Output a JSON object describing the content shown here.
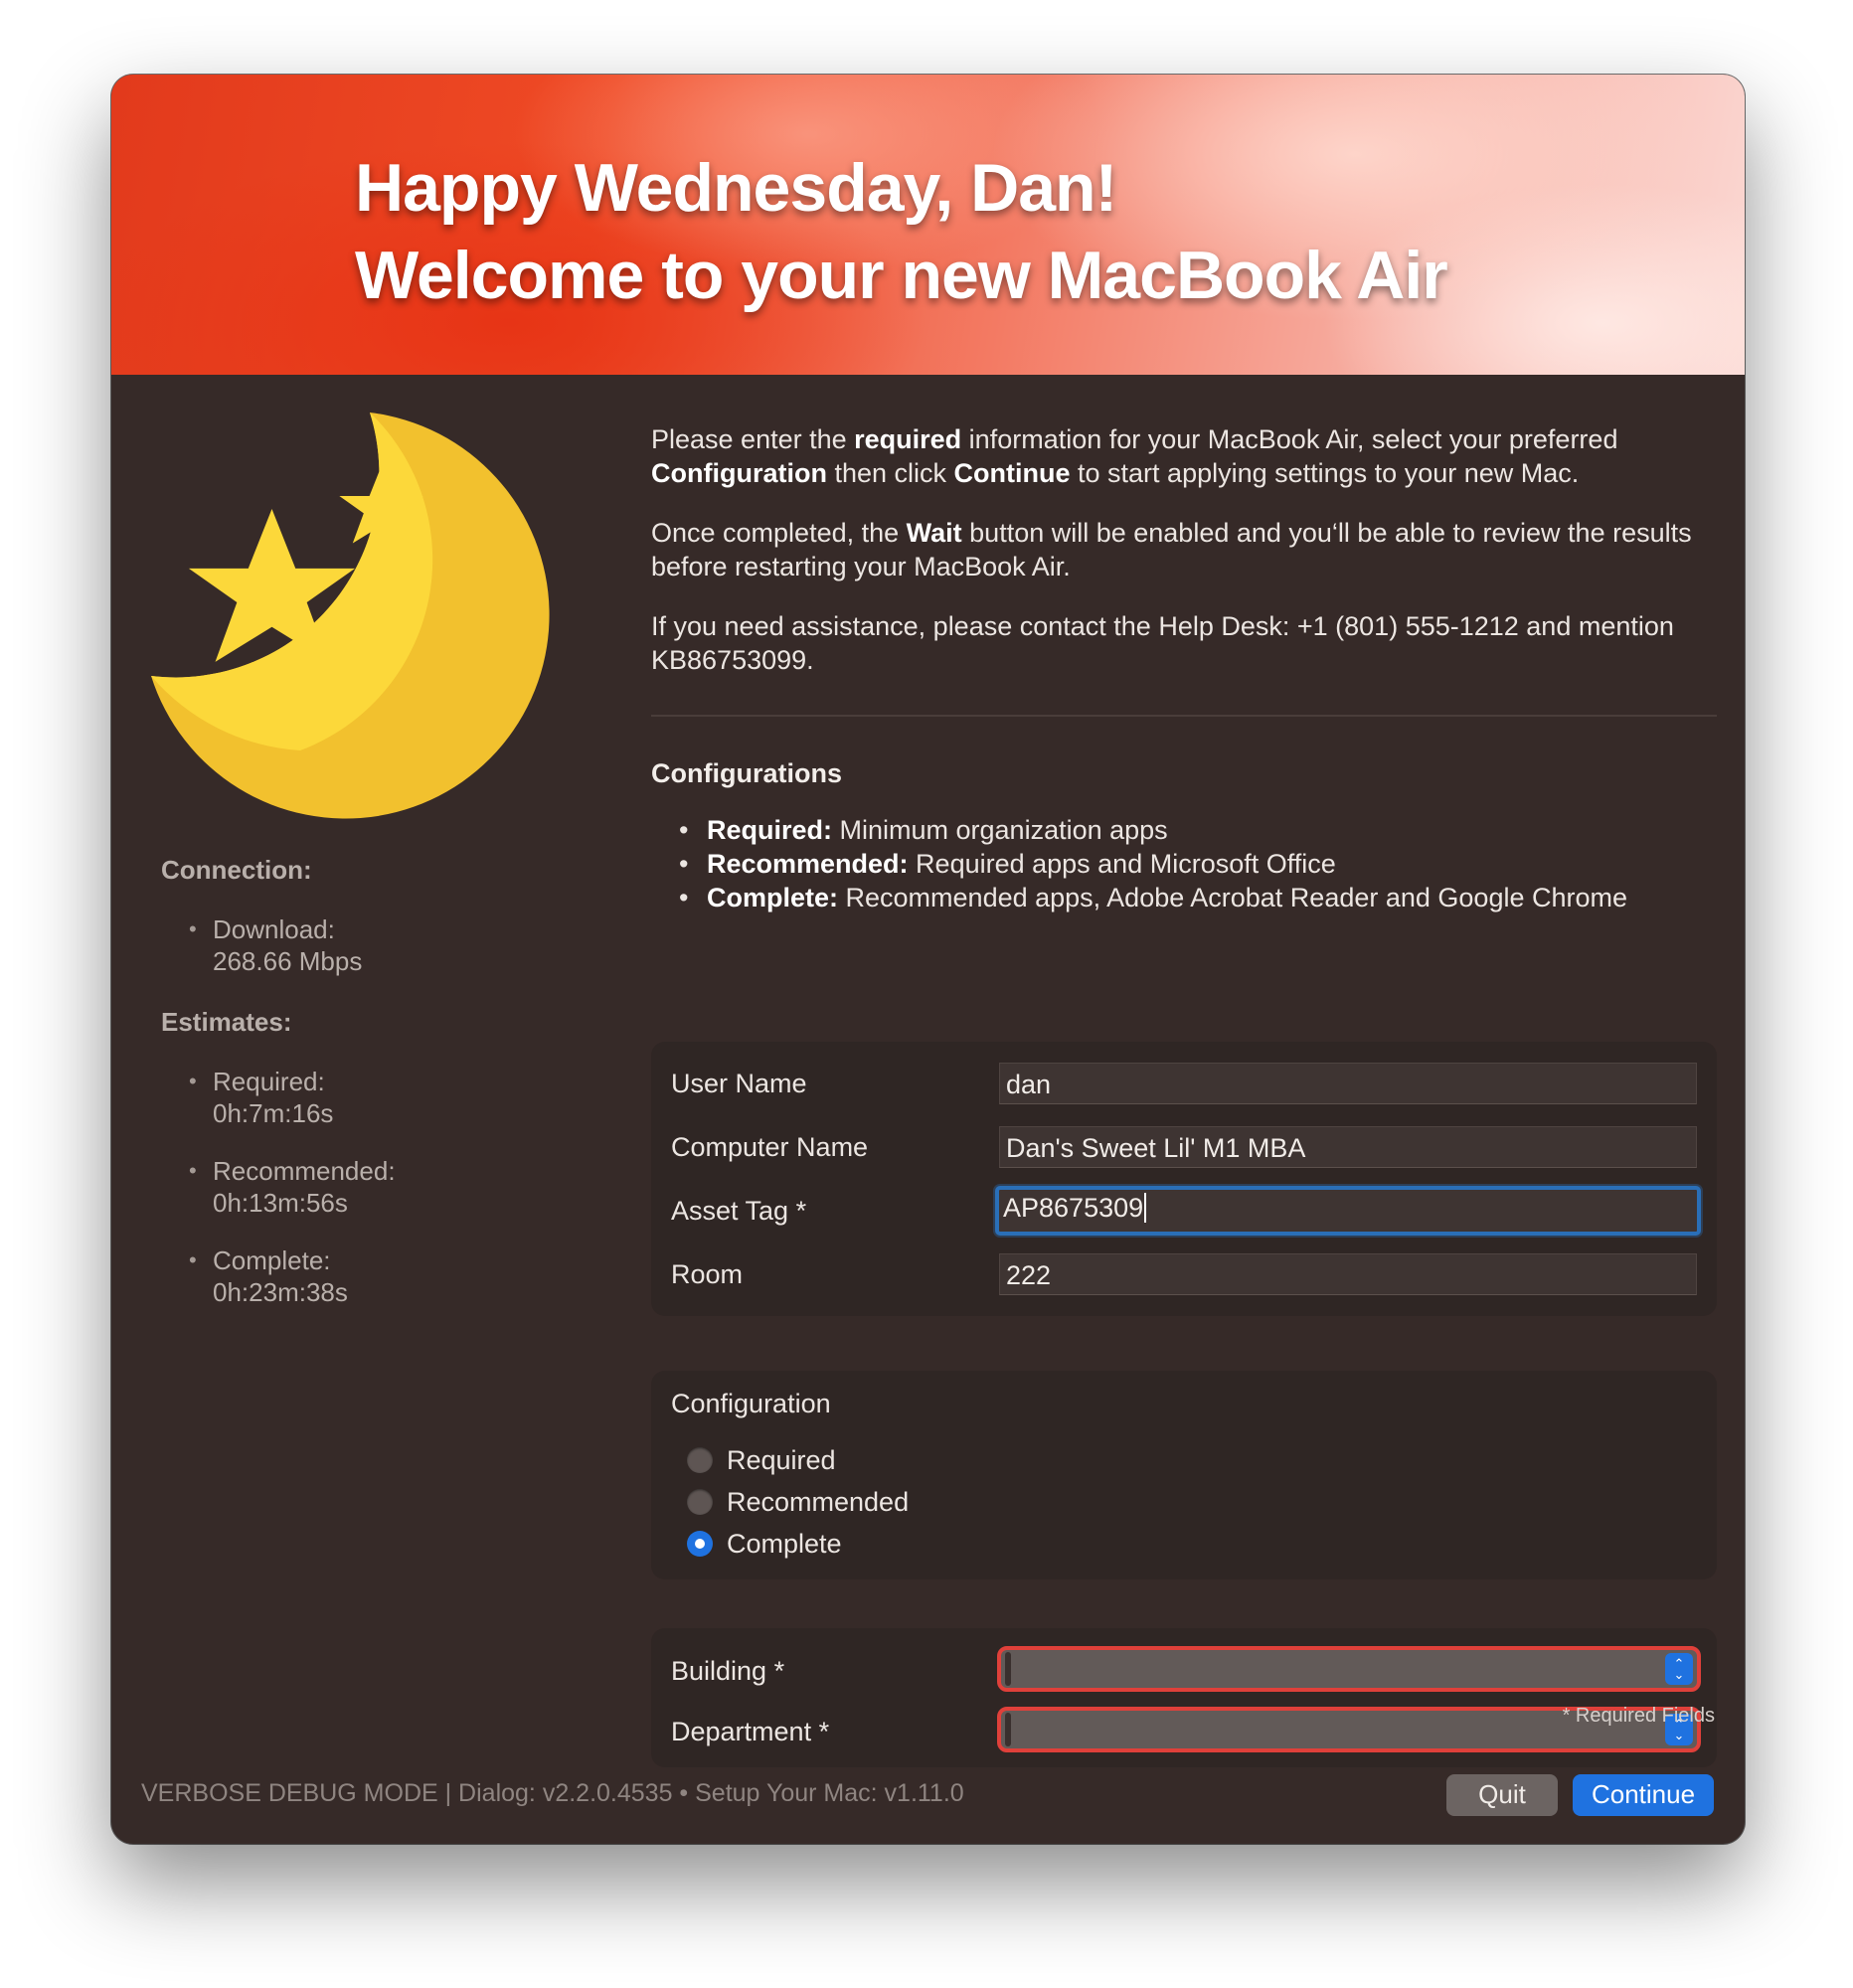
{
  "banner": {
    "line1": "Happy Wednesday, Dan!",
    "line2": "Welcome to your new MacBook Air"
  },
  "icon": "moon-stars-icon",
  "intro": {
    "p1": {
      "t1": "Please enter the ",
      "b1": "required",
      "t2": " information for your MacBook Air, select your preferred ",
      "b2": "Configuration",
      "t3": " then click ",
      "b3": "Continue",
      "t4": " to start applying settings to your new Mac."
    },
    "p2": {
      "t1": "Once completed, the ",
      "b1": "Wait",
      "t2": " button will be enabled and you‘ll be able to review the results before restarting your MacBook Air."
    },
    "p3": "If you need assistance, please contact the Help Desk: +1 (801) 555-1212 and mention KB86753099."
  },
  "configurations": {
    "heading": "Configurations",
    "items": [
      {
        "name": "Required:",
        "desc": " Minimum organization apps"
      },
      {
        "name": "Recommended:",
        "desc": " Required apps and Microsoft Office"
      },
      {
        "name": "Complete:",
        "desc": " Recommended apps, Adobe Acrobat Reader and Google Chrome"
      }
    ]
  },
  "sidebar": {
    "connection_heading": "Connection:",
    "download_label": "Download:",
    "download_value": "268.66 Mbps",
    "estimates_heading": "Estimates:",
    "estimates": [
      {
        "label": "Required:",
        "value": "0h:7m:16s"
      },
      {
        "label": "Recommended:",
        "value": "0h:13m:56s"
      },
      {
        "label": "Complete:",
        "value": "0h:23m:38s"
      }
    ]
  },
  "fields": {
    "user_name": {
      "label": "User Name",
      "value": "dan"
    },
    "computer_name": {
      "label": "Computer Name",
      "value": "Dan's Sweet Lil' M1 MBA"
    },
    "asset_tag": {
      "label": "Asset Tag *",
      "value": "AP8675309"
    },
    "room": {
      "label": "Room",
      "value": "222"
    }
  },
  "configuration": {
    "title": "Configuration",
    "options": [
      "Required",
      "Recommended",
      "Complete"
    ],
    "selected": "Complete"
  },
  "selects": {
    "building": {
      "label": "Building *",
      "value": ""
    },
    "department": {
      "label": "Department *",
      "value": ""
    }
  },
  "required_note": "* Required Fields",
  "footer": "VERBOSE DEBUG MODE | Dialog: v2.2.0.4535 • Setup Your Mac: v1.11.0",
  "buttons": {
    "quit": "Quit",
    "continue": "Continue"
  },
  "colors": {
    "accent": "#1f72e0",
    "error": "#e0403a",
    "window_bg": "#362a28"
  }
}
